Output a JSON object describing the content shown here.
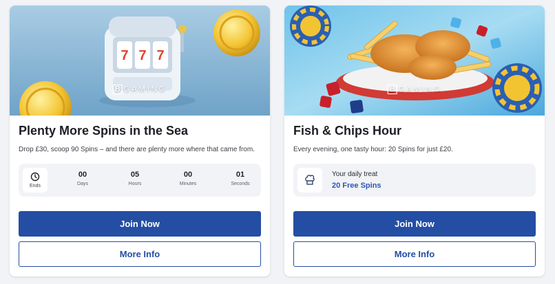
{
  "cards": [
    {
      "brand": "GAMING",
      "brand_letter": "B",
      "title": "Plenty More Spins in the Sea",
      "description": "Drop £30, scoop 90 Spins – and there are plenty more where that came from.",
      "countdown": {
        "ends_label": "Ends",
        "units": [
          {
            "value": "00",
            "label": "Days"
          },
          {
            "value": "05",
            "label": "Hours"
          },
          {
            "value": "00",
            "label": "Minutes"
          },
          {
            "value": "01",
            "label": "Seconds"
          }
        ]
      },
      "primary_button": "Join Now",
      "secondary_button": "More Info"
    },
    {
      "brand": "GAMING",
      "brand_letter": "B",
      "title": "Fish & Chips Hour",
      "description": "Every evening, one tasty hour: 20 Spins for just £20.",
      "treat": {
        "label": "Your daily treat",
        "value": "20 Free Spins"
      },
      "primary_button": "Join Now",
      "secondary_button": "More Info"
    }
  ],
  "colors": {
    "primary": "#244ea3",
    "link": "#2a58b5",
    "panel": "#f1f3f6"
  },
  "icons": [
    "slot-machine-image",
    "gold-coin-icon",
    "clock-icon",
    "chef-hat-icon",
    "poker-chip-icon",
    "dice-icon"
  ]
}
